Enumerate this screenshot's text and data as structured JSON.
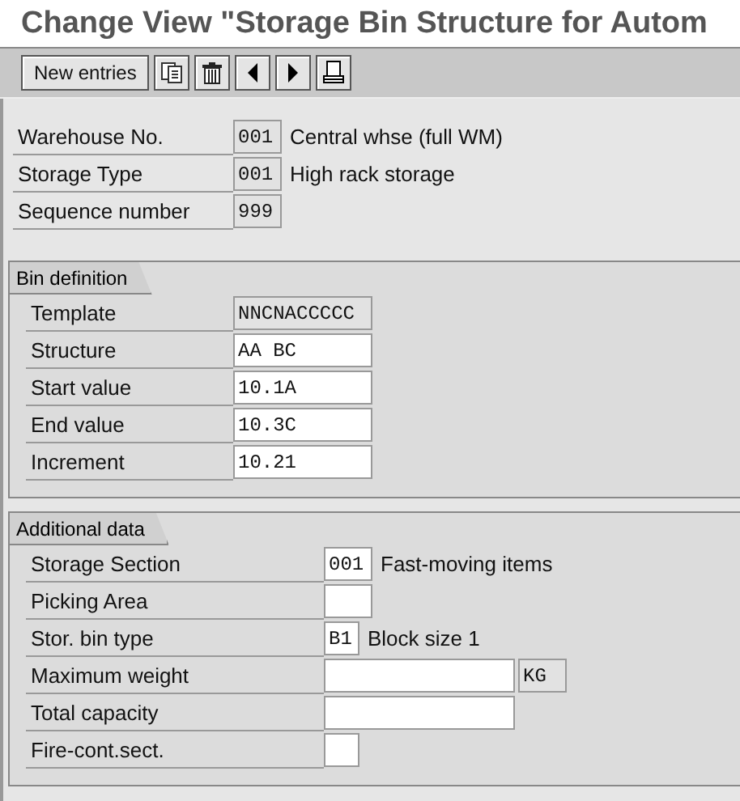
{
  "window": {
    "title": "Change View \"Storage Bin Structure for Autom"
  },
  "toolbar": {
    "buttons": [
      {
        "kind": "text",
        "label": "New entries"
      },
      {
        "kind": "copy"
      },
      {
        "kind": "delete"
      },
      {
        "kind": "previous"
      },
      {
        "kind": "next"
      },
      {
        "kind": "print"
      }
    ]
  },
  "header_fields": [
    {
      "label": "Warehouse No.",
      "value": "001",
      "editable": false,
      "description": "Central whse (full WM)"
    },
    {
      "label": "Storage Type",
      "value": "001",
      "editable": false,
      "description": "High rack storage"
    },
    {
      "label": "Sequence number",
      "value": "999",
      "editable": false
    }
  ],
  "groups": [
    {
      "title": "Bin definition",
      "fields": [
        {
          "label": "Template",
          "value": "NNCNACCCCC",
          "editable": false,
          "kind": "medium"
        },
        {
          "label": "Structure",
          "value": "AA BC",
          "editable": true,
          "kind": "medium"
        },
        {
          "label": "Start value",
          "value": "10.1A",
          "editable": true,
          "kind": "medium"
        },
        {
          "label": "End value",
          "value": "10.3C",
          "editable": true,
          "kind": "medium"
        },
        {
          "label": "Increment",
          "value": "10.21",
          "editable": true,
          "kind": "medium"
        }
      ]
    },
    {
      "title": "Additional data",
      "fields": [
        {
          "label": "Storage Section",
          "value": "001",
          "editable": true,
          "kind": "short",
          "description": "Fast-moving items"
        },
        {
          "label": "Picking Area",
          "editable": true,
          "kind": "short"
        },
        {
          "label": "Stor. bin type",
          "value": "B1",
          "editable": true,
          "kind": "tiny",
          "description": "Block size 1"
        },
        {
          "label": "Maximum weight",
          "editable": true,
          "kind": "long",
          "unit": "KG"
        },
        {
          "label": "Total capacity",
          "editable": true,
          "kind": "long"
        },
        {
          "label": "Fire-cont.sect.",
          "editable": true,
          "kind": "tiny"
        }
      ]
    }
  ]
}
